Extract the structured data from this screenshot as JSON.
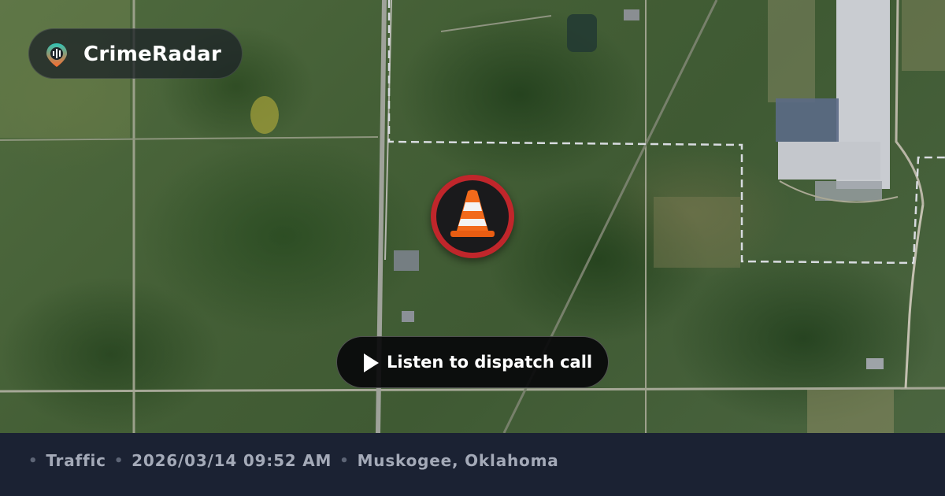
{
  "brand": {
    "name": "CrimeRadar",
    "logo_icon": "radar-pin-icon"
  },
  "map": {
    "marker_icon": "traffic-cone-icon",
    "marker_color": "#c0262b"
  },
  "action": {
    "label": "Listen to dispatch call",
    "icon": "play-icon"
  },
  "incident": {
    "category": "Traffic",
    "datetime": "2026/03/14 09:52 AM",
    "location": "Muskogee, Oklahoma"
  },
  "colors": {
    "footer_bg": "#1b2233",
    "footer_text": "#a4aab8",
    "button_bg": "#08080a",
    "logo_gradient": [
      "#2ec4b6",
      "#ff6b2b"
    ]
  }
}
